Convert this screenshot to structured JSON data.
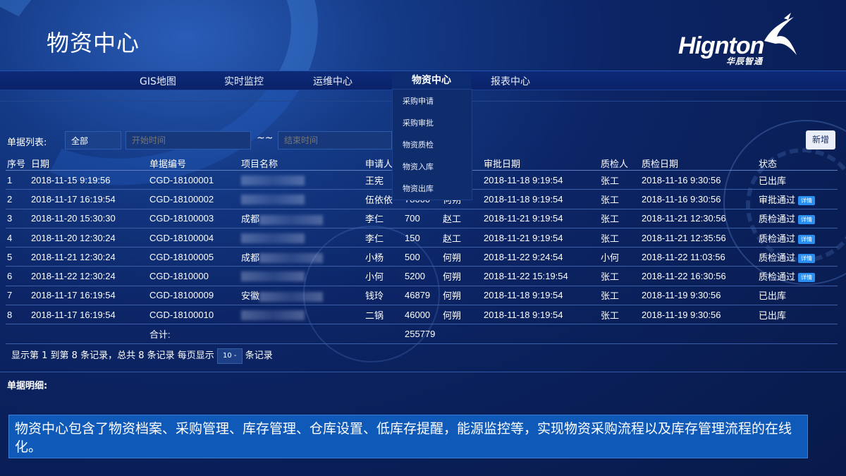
{
  "header": {
    "title": "物资中心",
    "logo_text": "Hignton",
    "logo_sub": "华辰智通"
  },
  "nav": {
    "items": [
      "GIS地图",
      "实时监控",
      "运维中心",
      "物资中心",
      "报表中心"
    ],
    "active": "物资中心",
    "dropdown": [
      "采购申请",
      "采购审批",
      "物资质检",
      "物资入库",
      "物资出库"
    ]
  },
  "filter": {
    "label": "单据列表:",
    "select_value": "全部",
    "start_placeholder": "开始时间",
    "separator": "~~",
    "end_placeholder": "结束时间",
    "add_label": "新增"
  },
  "table": {
    "columns": [
      "序号",
      "日期",
      "单据编号",
      "项目名称",
      "申请人",
      "",
      "",
      "审批日期",
      "质检人",
      "质检日期",
      "状态"
    ],
    "rows": [
      {
        "no": "1",
        "date": "2018-11-15 9:19:56",
        "code": "CGD-18100001",
        "project": "",
        "applicant": "王宪",
        "amount": "",
        "approver": "",
        "approve_date": "2018-11-18 9:19:54",
        "inspector": "张工",
        "inspect_date": "2018-11-16 9:30:56",
        "status": "已出库",
        "detail": ""
      },
      {
        "no": "2",
        "date": "2018-11-17 16:19:54",
        "code": "CGD-18100002",
        "project": "",
        "applicant": "伍依依",
        "amount": "78000",
        "approver": "何朔",
        "approve_date": "2018-11-18 9:19:54",
        "inspector": "张工",
        "inspect_date": "2018-11-16 9:30:56",
        "status": "审批通过",
        "detail": "详情"
      },
      {
        "no": "3",
        "date": "2018-11-20 15:30:30",
        "code": "CGD-18100003",
        "project": "成都",
        "applicant": "李仁",
        "amount": "700",
        "approver": "赵工",
        "approve_date": "2018-11-21 9:19:54",
        "inspector": "张工",
        "inspect_date": "2018-11-21 12:30:56",
        "status": "质检通过",
        "detail": "详情"
      },
      {
        "no": "4",
        "date": "2018-11-20 12:30:24",
        "code": "CGD-18100004",
        "project": "",
        "applicant": "李仁",
        "amount": "150",
        "approver": "赵工",
        "approve_date": "2018-11-21 9:19:54",
        "inspector": "张工",
        "inspect_date": "2018-11-21 12:35:56",
        "status": "质检通过",
        "detail": "详情"
      },
      {
        "no": "5",
        "date": "2018-11-21 12:30:24",
        "code": "CGD-18100005",
        "project": "成都",
        "applicant": "小杨",
        "amount": "500",
        "approver": "何朔",
        "approve_date": "2018-11-22 9:24:54",
        "inspector": "小何",
        "inspect_date": "2018-11-22 11:03:56",
        "status": "质检通过",
        "detail": "详情"
      },
      {
        "no": "6",
        "date": "2018-11-22 12:30:24",
        "code": "CGD-1810000",
        "project": "",
        "applicant": "小何",
        "amount": "5200",
        "approver": "何朔",
        "approve_date": "2018-11-22 15:19:54",
        "inspector": "张工",
        "inspect_date": "2018-11-22 16:30:56",
        "status": "质检通过",
        "detail": "详情"
      },
      {
        "no": "7",
        "date": "2018-11-17 16:19:54",
        "code": "CGD-18100009",
        "project": "安徽",
        "applicant": "钱玲",
        "amount": "46879",
        "approver": "何朔",
        "approve_date": "2018-11-18 9:19:54",
        "inspector": "张工",
        "inspect_date": "2018-11-19 9:30:56",
        "status": "已出库",
        "detail": ""
      },
      {
        "no": "8",
        "date": "2018-11-17 16:19:54",
        "code": "CGD-18100010",
        "project": "",
        "applicant": "二锅",
        "amount": "46000",
        "approver": "何朔",
        "approve_date": "2018-11-18 9:19:54",
        "inspector": "张工",
        "inspect_date": "2018-11-19 9:30:56",
        "status": "已出库",
        "detail": ""
      }
    ],
    "total_label": "合计:",
    "total_value": "255779"
  },
  "pager": {
    "text_before": "显示第 1 到第 8 条记录，总共 8 条记录 每页显示",
    "page_size": "10 -",
    "text_after": "条记录"
  },
  "detail_section": {
    "label": "单据明细:"
  },
  "caption": "物资中心包含了物资档案、采购管理、库存管理、仓库设置、低库存提醒，能源监控等，实现物资采购流程以及库存管理流程的在线化。"
}
